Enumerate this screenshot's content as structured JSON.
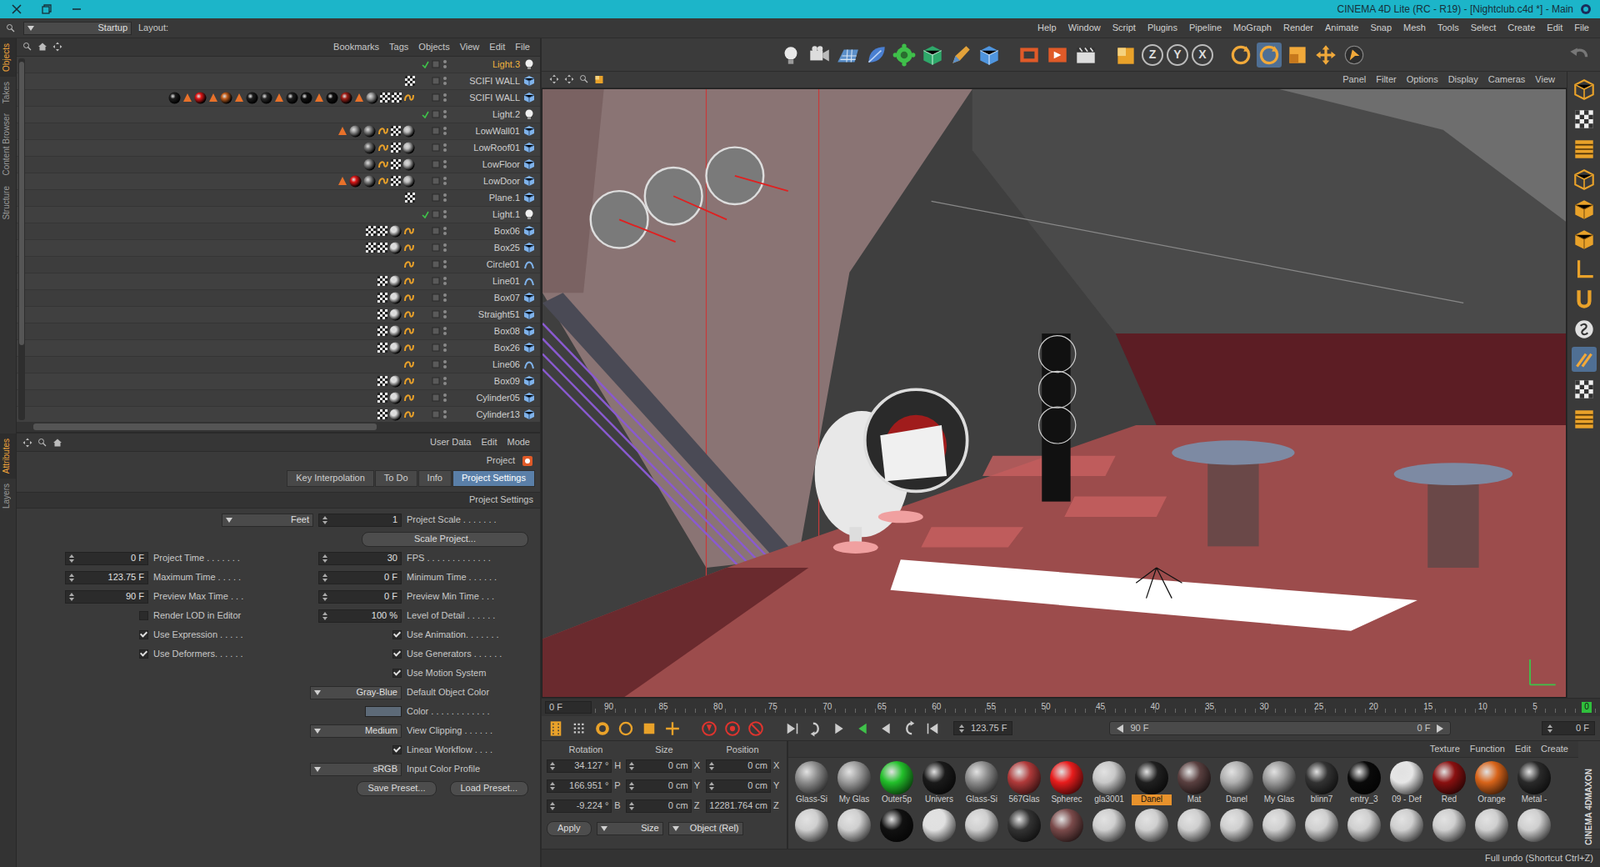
{
  "window": {
    "title": "CINEMA 4D Lite (RC - R19) - [Nightclub.c4d *] - Main"
  },
  "layout": {
    "label": "Layout:",
    "value": "Startup"
  },
  "menu": [
    "Help",
    "Window",
    "Script",
    "Plugins",
    "Pipeline",
    "MoGraph",
    "Render",
    "Animate",
    "Snap",
    "Mesh",
    "Tools",
    "Select",
    "Create",
    "Edit",
    "File"
  ],
  "toolbar": {
    "axes": [
      {
        "label": "Z",
        "selected": false
      },
      {
        "label": "Y",
        "selected": false
      },
      {
        "label": "X",
        "selected": false
      }
    ]
  },
  "left_tabs_top": [
    {
      "label": "Objects",
      "selected": true
    },
    {
      "label": "Takes",
      "selected": false
    },
    {
      "label": "Content Browser",
      "selected": false
    },
    {
      "label": "Structure",
      "selected": false
    }
  ],
  "left_tabs_bottom": [
    {
      "label": "Attributes",
      "selected": true
    },
    {
      "label": "Layers",
      "selected": false
    }
  ],
  "object_manager": {
    "menu": [
      "Bookmarks",
      "Tags",
      "Objects",
      "View",
      "Edit",
      "File"
    ],
    "objects": [
      {
        "name": "Light.3",
        "kind": "light",
        "selected": true,
        "enabled": true,
        "tags": []
      },
      {
        "name": "SCIFI WALL",
        "kind": "mesh",
        "selected": false,
        "enabled": false,
        "tags": [
          {
            "kind": "checker"
          }
        ]
      },
      {
        "name": "SCIFI WALL",
        "kind": "mesh",
        "selected": false,
        "enabled": false,
        "tags": [
          {
            "kind": "sphere",
            "color": "#1e1e1e"
          },
          {
            "kind": "tri"
          },
          {
            "kind": "sphere",
            "color": "#e01818"
          },
          {
            "kind": "tri"
          },
          {
            "kind": "sphere",
            "color": "#c2601e"
          },
          {
            "kind": "tri"
          },
          {
            "kind": "sphere",
            "color": "#1e1e1e"
          },
          {
            "kind": "sphere",
            "color": "#2a2a2a"
          },
          {
            "kind": "tri"
          },
          {
            "kind": "sphere",
            "color": "#1e1e1e"
          },
          {
            "kind": "sphere",
            "color": "#111111"
          },
          {
            "kind": "tri"
          },
          {
            "kind": "sphere",
            "color": "#111111"
          },
          {
            "kind": "sphere",
            "color": "#a02018"
          },
          {
            "kind": "tri"
          },
          {
            "kind": "sphere",
            "color": "#9a9a9a"
          },
          {
            "kind": "checker"
          },
          {
            "kind": "checker"
          },
          {
            "kind": "phong"
          }
        ]
      },
      {
        "name": "Light.2",
        "kind": "light",
        "selected": false,
        "enabled": true,
        "tags": []
      },
      {
        "name": "LowWall01",
        "kind": "mesh",
        "selected": false,
        "enabled": false,
        "tags": [
          {
            "kind": "tri"
          },
          {
            "kind": "sphere",
            "color": "#9a9a9a"
          },
          {
            "kind": "sphere",
            "color": "#8a8a8a"
          },
          {
            "kind": "phong"
          },
          {
            "kind": "checker"
          },
          {
            "kind": "sphere",
            "color": "#bdbdbd"
          }
        ]
      },
      {
        "name": "LowRoof01",
        "kind": "mesh",
        "selected": false,
        "enabled": false,
        "tags": [
          {
            "kind": "sphere",
            "color": "#777777"
          },
          {
            "kind": "phong"
          },
          {
            "kind": "checker"
          },
          {
            "kind": "sphere",
            "color": "#bdbdbd"
          }
        ]
      },
      {
        "name": "LowFloor",
        "kind": "mesh",
        "selected": false,
        "enabled": false,
        "tags": [
          {
            "kind": "sphere",
            "color": "#858585"
          },
          {
            "kind": "phong"
          },
          {
            "kind": "checker"
          },
          {
            "kind": "sphere",
            "color": "#bdbdbd"
          }
        ]
      },
      {
        "name": "LowDoor",
        "kind": "mesh",
        "selected": false,
        "enabled": false,
        "tags": [
          {
            "kind": "tri"
          },
          {
            "kind": "sphere",
            "color": "#e01818"
          },
          {
            "kind": "sphere",
            "color": "#8a8a8a"
          },
          {
            "kind": "phong"
          },
          {
            "kind": "checker"
          },
          {
            "kind": "sphere",
            "color": "#bdbdbd"
          }
        ]
      },
      {
        "name": "Plane.1",
        "kind": "mesh",
        "selected": false,
        "enabled": false,
        "tags": [
          {
            "kind": "checker"
          }
        ]
      },
      {
        "name": "Light.1",
        "kind": "light",
        "selected": false,
        "enabled": true,
        "tags": []
      },
      {
        "name": "Box06",
        "kind": "mesh",
        "selected": false,
        "enabled": false,
        "tags": [
          {
            "kind": "checker"
          },
          {
            "kind": "checker"
          },
          {
            "kind": "sphere",
            "color": "#dddddd"
          },
          {
            "kind": "phong"
          }
        ]
      },
      {
        "name": "Box25",
        "kind": "mesh",
        "selected": false,
        "enabled": false,
        "tags": [
          {
            "kind": "checker"
          },
          {
            "kind": "checker"
          },
          {
            "kind": "sphere",
            "color": "#dddddd"
          },
          {
            "kind": "phong"
          }
        ]
      },
      {
        "name": "Circle01",
        "kind": "spline",
        "selected": false,
        "enabled": false,
        "tags": [
          {
            "kind": "phong"
          }
        ]
      },
      {
        "name": "Line01",
        "kind": "spline",
        "selected": false,
        "enabled": false,
        "tags": [
          {
            "kind": "checker"
          },
          {
            "kind": "sphere",
            "color": "#dddddd"
          },
          {
            "kind": "phong"
          }
        ]
      },
      {
        "name": "Box07",
        "kind": "mesh",
        "selected": false,
        "enabled": false,
        "tags": [
          {
            "kind": "checker"
          },
          {
            "kind": "sphere",
            "color": "#dddddd"
          },
          {
            "kind": "phong"
          }
        ]
      },
      {
        "name": "Straight51",
        "kind": "mesh",
        "selected": false,
        "enabled": false,
        "tags": [
          {
            "kind": "checker"
          },
          {
            "kind": "sphere",
            "color": "#dddddd"
          },
          {
            "kind": "phong"
          }
        ]
      },
      {
        "name": "Box08",
        "kind": "mesh",
        "selected": false,
        "enabled": false,
        "tags": [
          {
            "kind": "checker"
          },
          {
            "kind": "sphere",
            "color": "#dddddd"
          },
          {
            "kind": "phong"
          }
        ]
      },
      {
        "name": "Box26",
        "kind": "mesh",
        "selected": false,
        "enabled": false,
        "tags": [
          {
            "kind": "checker"
          },
          {
            "kind": "sphere",
            "color": "#dddddd"
          },
          {
            "kind": "phong"
          }
        ]
      },
      {
        "name": "Line06",
        "kind": "spline",
        "selected": false,
        "enabled": false,
        "tags": [
          {
            "kind": "phong"
          }
        ]
      },
      {
        "name": "Box09",
        "kind": "mesh",
        "selected": false,
        "enabled": false,
        "tags": [
          {
            "kind": "checker"
          },
          {
            "kind": "sphere",
            "color": "#dddddd"
          },
          {
            "kind": "phong"
          }
        ]
      },
      {
        "name": "Cylinder05",
        "kind": "mesh",
        "selected": false,
        "enabled": false,
        "tags": [
          {
            "kind": "checker"
          },
          {
            "kind": "sphere",
            "color": "#dddddd"
          },
          {
            "kind": "phong"
          }
        ]
      },
      {
        "name": "Cylinder13",
        "kind": "mesh",
        "selected": false,
        "enabled": false,
        "tags": [
          {
            "kind": "checker"
          },
          {
            "kind": "sphere",
            "color": "#dddddd"
          },
          {
            "kind": "phong"
          }
        ]
      }
    ]
  },
  "attributes": {
    "menu": [
      "User Data",
      "Edit",
      "Mode"
    ],
    "title": "Project",
    "tabs": [
      {
        "label": "Key Interpolation",
        "selected": false
      },
      {
        "label": "To Do",
        "selected": false
      },
      {
        "label": "Info",
        "selected": false
      },
      {
        "label": "Project Settings",
        "selected": true
      }
    ],
    "section": "Project Settings",
    "rows": [
      [
        {
          "kind": "field",
          "label": "Project Scale . . . . . . .",
          "value": "1",
          "unit": "Feet"
        }
      ],
      [
        {
          "kind": "button",
          "label": "Scale Project..."
        }
      ],
      [
        {
          "kind": "field",
          "label": "FPS . . . . . . . . . . . . .",
          "value": "30"
        },
        {
          "kind": "field",
          "label": "Project Time . . . . . . .",
          "value": "0 F"
        }
      ],
      [
        {
          "kind": "field",
          "label": "Minimum Time . . . . . .",
          "value": "0 F"
        },
        {
          "kind": "field",
          "label": "Maximum Time . . . . .",
          "value": "123.75 F"
        }
      ],
      [
        {
          "kind": "field",
          "label": "Preview Min Time . . .",
          "value": "0 F"
        },
        {
          "kind": "field",
          "label": "Preview Max Time . . .",
          "value": "90 F"
        }
      ],
      [
        {
          "kind": "field",
          "label": "Level of Detail . . . . . .",
          "value": "100 %"
        },
        {
          "kind": "check",
          "label": "Render LOD in Editor",
          "checked": false
        }
      ],
      [
        {
          "kind": "check",
          "label": "Use Animation. . . . . . .",
          "checked": true
        },
        {
          "kind": "check",
          "label": "Use Expression . . . . .",
          "checked": true
        }
      ],
      [
        {
          "kind": "check",
          "label": "Use Generators . . . . . .",
          "checked": true
        },
        {
          "kind": "check",
          "label": "Use Deformers. . . . . .",
          "checked": true
        }
      ],
      [
        {
          "kind": "check",
          "label": "Use Motion System",
          "checked": true
        }
      ],
      [
        {
          "kind": "dropdown",
          "label": "Default Object Color",
          "value": "Gray-Blue"
        }
      ],
      [
        {
          "kind": "color",
          "label": "Color . . . . . . . . . . . .",
          "color": "#5d6a78"
        }
      ],
      [
        {
          "kind": "dropdown",
          "label": "View Clipping . . . . . .",
          "value": "Medium"
        }
      ],
      [
        {
          "kind": "check",
          "label": "Linear Workflow . . . .",
          "checked": true
        }
      ],
      [
        {
          "kind": "dropdown",
          "label": "Input Color Profile",
          "value": "sRGB"
        }
      ],
      [
        {
          "kind": "button",
          "label": "Load Preset..."
        },
        {
          "kind": "button",
          "label": "Save Preset..."
        }
      ]
    ]
  },
  "viewport": {
    "menu": [
      "Panel",
      "Filter",
      "Options",
      "Display",
      "Cameras",
      "View"
    ]
  },
  "timeline": {
    "start": "0 F",
    "ticks": [
      {
        "label": "90",
        "selected": false
      },
      {
        "label": "85",
        "selected": false
      },
      {
        "label": "80",
        "selected": false
      },
      {
        "label": "75",
        "selected": false
      },
      {
        "label": "70",
        "selected": false
      },
      {
        "label": "65",
        "selected": false
      },
      {
        "label": "60",
        "selected": false
      },
      {
        "label": "55",
        "selected": false
      },
      {
        "label": "50",
        "selected": false
      },
      {
        "label": "45",
        "selected": false
      },
      {
        "label": "40",
        "selected": false
      },
      {
        "label": "35",
        "selected": false
      },
      {
        "label": "30",
        "selected": false
      },
      {
        "label": "25",
        "selected": false
      },
      {
        "label": "20",
        "selected": false
      },
      {
        "label": "15",
        "selected": false
      },
      {
        "label": "10",
        "selected": false
      },
      {
        "label": "5",
        "selected": false
      },
      {
        "label": "0",
        "selected": true
      }
    ],
    "end": "123.75 F",
    "range_start": "90 F",
    "range_end": "0 F",
    "current": "0 F"
  },
  "coordinates": {
    "headers": [
      "Rotation",
      "Size",
      "Position"
    ],
    "rows": [
      {
        "rot_axis": "H",
        "rot": "34.127 °",
        "size_axis": "X",
        "size": "0 cm",
        "pos_axis": "X",
        "pos": "0 cm"
      },
      {
        "rot_axis": "P",
        "rot": "166.951 °",
        "size_axis": "Y",
        "size": "0 cm",
        "pos_axis": "Y",
        "pos": "0 cm"
      },
      {
        "rot_axis": "B",
        "rot": "-9.224 °",
        "size_axis": "Z",
        "size": "0 cm",
        "pos_axis": "Z",
        "pos": "12281.764 cm"
      }
    ],
    "apply": "Apply",
    "size_mode": "Size",
    "coord_mode": "Object (Rel)"
  },
  "materials": {
    "menu": [
      "Texture",
      "Function",
      "Edit",
      "Create"
    ],
    "items": [
      {
        "name": "Glass-Si",
        "color": "#8c8c8c",
        "selected": false
      },
      {
        "name": "My Glas",
        "color": "#9a9a9a",
        "selected": false
      },
      {
        "name": "Outer5p",
        "color": "#22c02a",
        "selected": false
      },
      {
        "name": "Univers",
        "color": "#1a1a1a",
        "selected": false
      },
      {
        "name": "Glass-Si",
        "color": "#8c8c8c",
        "selected": false
      },
      {
        "name": "567Glas",
        "color": "#b03a3a",
        "selected": false
      },
      {
        "name": "Spherec",
        "color": "#e81c1c",
        "selected": false
      },
      {
        "name": "gla3001",
        "color": "#c8c8c8",
        "selected": false
      },
      {
        "name": "Danel",
        "color": "#202020",
        "selected": true
      },
      {
        "name": "Mat",
        "color": "#5a4040",
        "selected": false
      },
      {
        "name": "Danel",
        "color": "#b0b0b0",
        "selected": false
      },
      {
        "name": "My Glas",
        "color": "#9a9a9a",
        "selected": false
      },
      {
        "name": "blinn7",
        "color": "#333333",
        "selected": false
      },
      {
        "name": "entry_3",
        "color": "#0a0a0a",
        "selected": false
      },
      {
        "name": "09 - Def",
        "color": "#e6e6e6",
        "selected": false
      },
      {
        "name": "Red",
        "color": "#8a1010",
        "selected": false
      },
      {
        "name": "Orange",
        "color": "#d8641a",
        "selected": false
      },
      {
        "name": "Metal -",
        "color": "#2a2a2a",
        "selected": false
      }
    ],
    "second_row": [
      "#cfcfcf",
      "#cfcfcf",
      "#111111",
      "#e0e0e0",
      "#cfcfcf",
      "#333333",
      "#7a4a4a",
      "#cfcfcf",
      "#cfcfcf",
      "#cfcfcf",
      "#cfcfcf",
      "#cfcfcf",
      "#cfcfcf",
      "#cfcfcf",
      "#cfcfcf",
      "#cfcfcf",
      "#cfcfcf",
      "#cfcfcf"
    ]
  },
  "logo": [
    "MAXON",
    "CINEMA 4D"
  ],
  "status_bar": "Full undo (Shortcut Ctrl+Z)"
}
